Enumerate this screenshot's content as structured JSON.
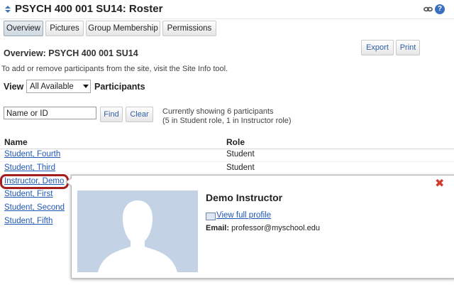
{
  "header": {
    "title": "PSYCH 400 001 SU14: Roster",
    "help_glyph": "?"
  },
  "tabs": [
    {
      "label": "Overview",
      "active": true
    },
    {
      "label": "Pictures",
      "active": false
    },
    {
      "label": "Group Membership",
      "active": false
    },
    {
      "label": "Permissions",
      "active": false
    }
  ],
  "actions": {
    "export_label": "Export",
    "print_label": "Print"
  },
  "overview": {
    "heading": "Overview: PSYCH 400 001 SU14",
    "info": "To add or remove participants from the site, visit the Site Info tool."
  },
  "view": {
    "label": "View",
    "selected": "All Available",
    "participants_label": "Participants"
  },
  "search": {
    "value": "Name or ID",
    "find_label": "Find",
    "clear_label": "Clear",
    "showing_line1": "Currently showing 6 participants",
    "showing_line2": "(5 in Student role, 1 in Instructor role)"
  },
  "table": {
    "columns": [
      "Name",
      "Role"
    ],
    "rows": [
      {
        "name": "Student, Fourth",
        "role": "Student"
      },
      {
        "name": "Student, Third",
        "role": "Student"
      },
      {
        "name": "Instructor, Demo",
        "role": ""
      },
      {
        "name": "Student, First",
        "role": ""
      },
      {
        "name": "Student, Second",
        "role": ""
      },
      {
        "name": "Student, Fifth",
        "role": ""
      }
    ]
  },
  "popup": {
    "name": "Demo Instructor",
    "profile_link": "View full profile",
    "email_label": "Email:",
    "email": "professor@myschool.edu",
    "close_glyph": "✖"
  },
  "colors": {
    "link": "#1f57b5",
    "highlight": "#a51d1d",
    "close": "#d23a2d",
    "avatar_bg": "#c4d2e6"
  }
}
